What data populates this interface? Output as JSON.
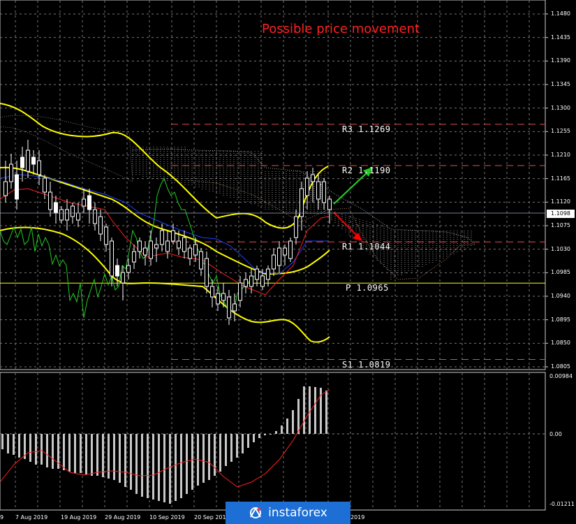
{
  "chart": {
    "title": "Possible price movement",
    "current_price": "1.1098",
    "price_scale": [
      "1.1480",
      "1.1435",
      "1.1390",
      "1.1345",
      "1.1300",
      "1.1255",
      "1.1210",
      "1.1165",
      "1.1120",
      "1.1075",
      "1.1030",
      "1.0985",
      "1.0940",
      "1.0895",
      "1.0850",
      "1.0805"
    ],
    "levels": [
      {
        "name": "R3",
        "value": "1.1269",
        "label": "R3 1.1269"
      },
      {
        "name": "R2",
        "value": "1.1190",
        "label": "R2 1.1190"
      },
      {
        "name": "R1",
        "value": "1.1044",
        "label": "R1 1.1044"
      },
      {
        "name": "P",
        "value": "1.0965",
        "label": "P 1.0965"
      },
      {
        "name": "S1",
        "value": "1.0819",
        "label": "S1 1.0819"
      }
    ],
    "dates": [
      "9",
      "7 Aug 2019",
      "19 Aug 2019",
      "29 Aug 2019",
      "10 Sep 2019",
      "20 Sep 2019",
      "2019"
    ],
    "colors": {
      "bullish_arrow": "#22cc22",
      "bearish_arrow": "#ff0000",
      "bollinger": "#ffff00",
      "pivot": "#ff4444",
      "tenkan": "#ff2020",
      "kijun": "#2040ff",
      "chikou": "#22cc22",
      "histogram": "#bfbfbf",
      "signal": "#ff2020"
    }
  },
  "oscillator": {
    "scale": [
      "0.00984",
      "0.00",
      "-0.01211"
    ]
  },
  "logo": {
    "text": "instaforex",
    "icon": "instaforex-logo-icon"
  }
}
